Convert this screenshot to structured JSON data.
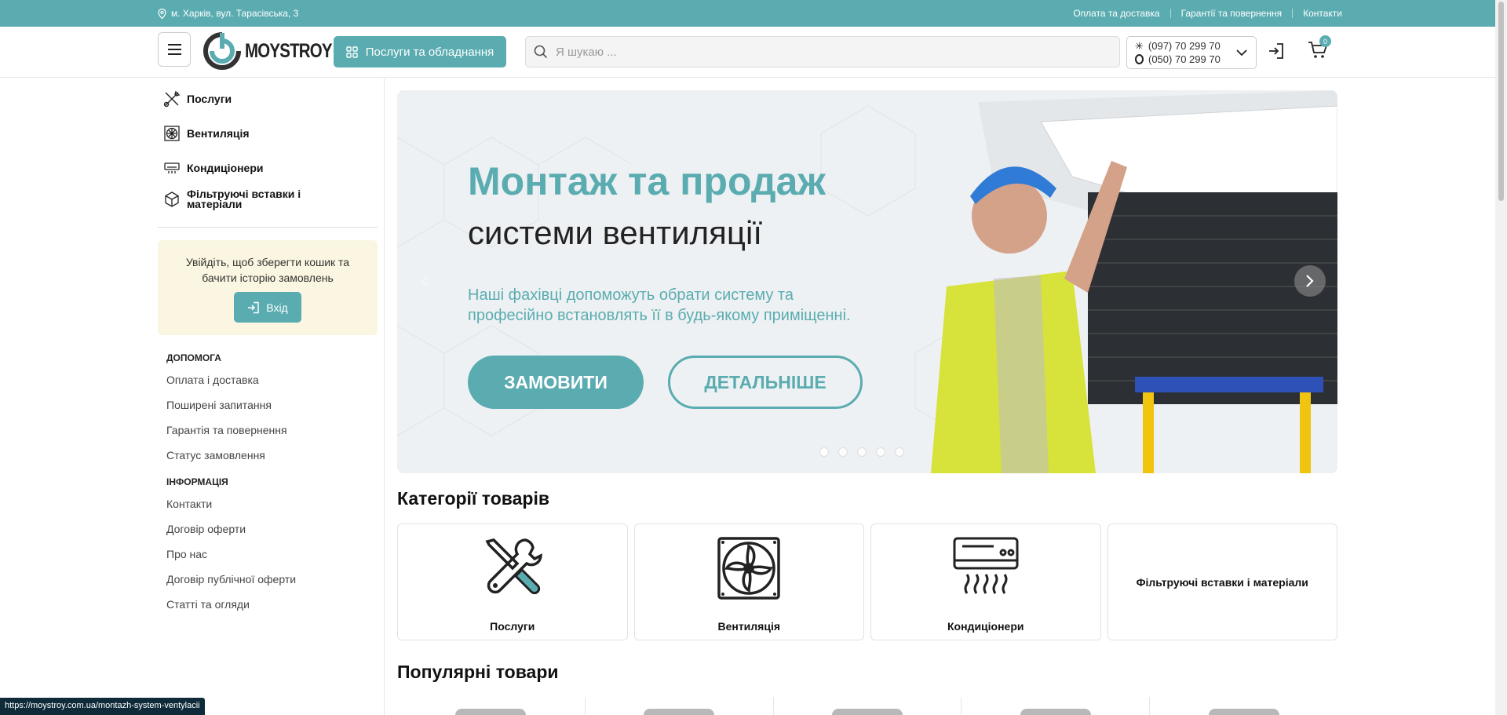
{
  "topbar": {
    "address": "м. Харків, вул. Тарасівська, 3",
    "links": [
      "Оплата та доставка",
      "Гарантії та повернення",
      "Контакти"
    ]
  },
  "header": {
    "logo_text": "MOYSTROY",
    "services_button": "Послуги та обладнання",
    "search_placeholder": "Я шукаю ...",
    "phone_1": "(097) 70 299 70",
    "phone_2": "(050) 70 299 70",
    "cart_count": "0"
  },
  "sidebar": {
    "categories": [
      "Послуги",
      "Вентиляція",
      "Кондиціонери",
      "Фільтруючі вставки і матеріали"
    ],
    "login_prompt_line1": "Увійдіть, щоб зберегти кошик та",
    "login_prompt_line2": "бачити історію замовлень",
    "login_button": "Вхід",
    "help_heading": "ДОПОМОГА",
    "help_links": [
      "Оплата і доставка",
      "Поширені запитання",
      "Гарантія та повернення",
      "Статус замовлення"
    ],
    "info_heading": "ІНФОРМАЦІЯ",
    "info_links": [
      "Контакти",
      "Договір оферти",
      "Про нас",
      "Договір публічної оферти",
      "Статті та огляди"
    ]
  },
  "banner": {
    "title_line1": "Монтаж та продаж",
    "title_line2": "системи вентиляції",
    "subtitle_line1": "Наші фахівці допоможуть обрати систему та",
    "subtitle_line2": "професійно встановлять її в будь-якому приміщенні.",
    "order_button": "ЗАМОВИТИ",
    "details_button": "ДЕТАЛЬНІШЕ",
    "slide_count": 5,
    "active_slide": 1
  },
  "categories_section": {
    "title": "Категорії товарів",
    "cards": [
      "Послуги",
      "Вентиляція",
      "Кондиціонери",
      "Фільтруючі вставки і матеріали"
    ]
  },
  "popular_section": {
    "title": "Популярні товари"
  },
  "status_url": "https://moystroy.com.ua/montazh-system-ventylacii",
  "colors": {
    "accent": "#5aacb0",
    "login_box_bg": "#faf6e1"
  }
}
